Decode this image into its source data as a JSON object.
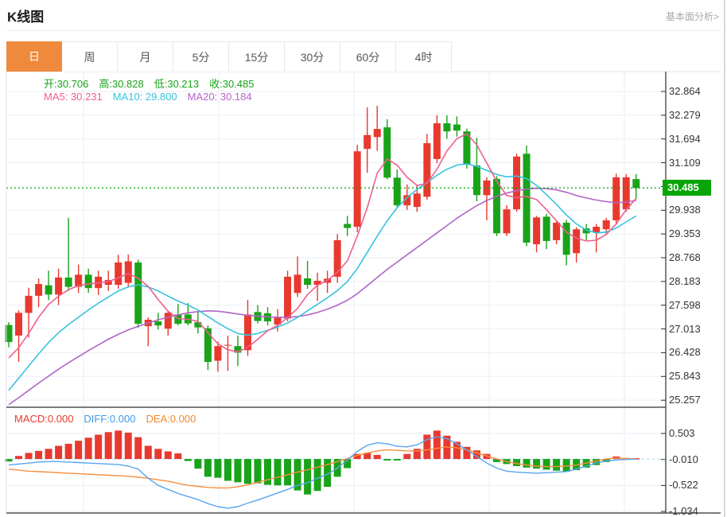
{
  "header": {
    "title": "K线图",
    "link": "基本面分析>"
  },
  "tabs": [
    {
      "name": "day",
      "label": "日",
      "active": true
    },
    {
      "name": "week",
      "label": "周",
      "active": false
    },
    {
      "name": "month",
      "label": "月",
      "active": false
    },
    {
      "name": "5min",
      "label": "5分",
      "active": false
    },
    {
      "name": "15min",
      "label": "15分",
      "active": false
    },
    {
      "name": "30min",
      "label": "30分",
      "active": false
    },
    {
      "name": "60min",
      "label": "60分",
      "active": false
    },
    {
      "name": "4hour",
      "label": "4时",
      "active": false
    }
  ],
  "legend_ohlc": [
    "开:30.706",
    "高:30.828",
    "低:30.213",
    "收:30.485"
  ],
  "legend_ohlc_color": "#17a317",
  "legend_ma": [
    {
      "text": "MA5: 30.231",
      "color": "#ee5f8e"
    },
    {
      "text": "MA10: 29.800",
      "color": "#38c2de"
    },
    {
      "text": "MA20: 30.184",
      "color": "#b264c8"
    }
  ],
  "legend_macd": [
    {
      "text": "MACD:0.000",
      "color": "#e8392f"
    },
    {
      "text": "DIFF:0.000",
      "color": "#3d9bea"
    },
    {
      "text": "DEA:0.000",
      "color": "#f0882c"
    }
  ],
  "price_axis": {
    "current": "30.485",
    "ticks": [
      {
        "label": "32.864",
        "value": 32.864
      },
      {
        "label": "32.279",
        "value": 32.279
      },
      {
        "label": "31.694",
        "value": 31.694
      },
      {
        "label": "31.109",
        "value": 31.109
      },
      {
        "label": "",
        "value": 30.524
      },
      {
        "label": "29.938",
        "value": 29.938
      },
      {
        "label": "29.353",
        "value": 29.353
      },
      {
        "label": "28.768",
        "value": 28.768
      },
      {
        "label": "28.183",
        "value": 28.183
      },
      {
        "label": "27.598",
        "value": 27.598
      },
      {
        "label": "27.013",
        "value": 27.013
      },
      {
        "label": "26.428",
        "value": 26.428
      },
      {
        "label": "25.843",
        "value": 25.843
      },
      {
        "label": "25.257",
        "value": 25.257
      }
    ]
  },
  "macd_axis": {
    "ticks": [
      {
        "label": "0.503",
        "value": 0.503
      },
      {
        "label": "-0.010",
        "value": -0.01
      },
      {
        "label": "-0.522",
        "value": -0.522
      },
      {
        "label": "-1.034",
        "value": -1.034
      }
    ]
  },
  "chart_data": {
    "type": "candlestick",
    "panels": [
      "price",
      "macd"
    ],
    "ohlc_current": {
      "open": 30.706,
      "high": 30.828,
      "low": 30.213,
      "close": 30.485
    },
    "ma_current": {
      "ma5": 30.231,
      "ma10": 29.8,
      "ma20": 30.184
    },
    "macd_current": {
      "macd": 0.0,
      "diff": 0.0,
      "dea": 0.0
    },
    "current_price": 30.485,
    "price_tick_step": 0.585,
    "ylim": [
      25.08,
      33.35
    ],
    "macd_ylim": [
      -1.07,
      0.55
    ],
    "candles": [
      [
        27.11,
        27.18,
        26.56,
        26.69
      ],
      [
        26.85,
        27.47,
        26.2,
        27.41
      ],
      [
        27.41,
        28.03,
        26.8,
        27.83
      ],
      [
        27.83,
        28.26,
        27.55,
        28.12
      ],
      [
        28.09,
        28.45,
        27.72,
        27.86
      ],
      [
        27.86,
        28.5,
        27.6,
        28.28
      ],
      [
        28.28,
        29.75,
        27.95,
        28.05
      ],
      [
        28.05,
        28.6,
        27.9,
        28.35
      ],
      [
        28.35,
        28.5,
        27.9,
        28.02
      ],
      [
        28.02,
        28.45,
        27.85,
        28.3
      ],
      [
        28.1,
        28.45,
        27.95,
        28.22
      ],
      [
        28.1,
        28.84,
        28.0,
        28.65
      ],
      [
        28.15,
        28.85,
        28.05,
        28.68
      ],
      [
        28.65,
        28.72,
        27.04,
        27.14
      ],
      [
        27.08,
        27.3,
        26.59,
        27.24
      ],
      [
        27.2,
        27.41,
        27.0,
        27.1
      ],
      [
        27.02,
        27.45,
        26.85,
        27.41
      ],
      [
        27.37,
        27.63,
        27.1,
        27.14
      ],
      [
        27.37,
        27.65,
        27.1,
        27.15
      ],
      [
        27.18,
        27.45,
        26.9,
        27.05
      ],
      [
        27.03,
        27.1,
        26.0,
        26.2
      ],
      [
        26.23,
        26.7,
        25.96,
        26.59
      ],
      [
        26.6,
        26.85,
        25.98,
        26.62
      ],
      [
        26.59,
        26.85,
        26.1,
        26.43
      ],
      [
        26.49,
        27.73,
        26.35,
        27.37
      ],
      [
        27.43,
        27.6,
        27.15,
        27.21
      ],
      [
        27.4,
        27.55,
        27.1,
        27.2
      ],
      [
        27.12,
        27.5,
        26.95,
        27.31
      ],
      [
        27.27,
        28.45,
        27.2,
        28.3
      ],
      [
        27.9,
        28.8,
        27.8,
        28.35
      ],
      [
        28.26,
        28.69,
        28.0,
        28.1
      ],
      [
        28.1,
        28.4,
        27.7,
        28.2
      ],
      [
        28.15,
        28.45,
        27.9,
        28.25
      ],
      [
        28.3,
        29.35,
        28.15,
        29.2
      ],
      [
        29.6,
        29.8,
        29.3,
        29.5
      ],
      [
        29.53,
        31.55,
        29.4,
        31.39
      ],
      [
        31.45,
        32.47,
        30.86,
        31.79
      ],
      [
        31.74,
        32.51,
        31.4,
        31.94
      ],
      [
        31.98,
        32.18,
        30.7,
        30.74
      ],
      [
        30.74,
        30.94,
        30.0,
        30.06
      ],
      [
        30.06,
        30.57,
        29.95,
        30.31
      ],
      [
        30.02,
        30.55,
        29.9,
        30.35
      ],
      [
        30.27,
        31.82,
        30.2,
        31.59
      ],
      [
        31.2,
        32.28,
        31.1,
        32.08
      ],
      [
        32.08,
        32.28,
        31.7,
        31.88
      ],
      [
        32.05,
        32.25,
        31.75,
        31.9
      ],
      [
        31.88,
        31.95,
        30.96,
        31.06
      ],
      [
        31.04,
        31.72,
        30.16,
        30.31
      ],
      [
        30.31,
        30.75,
        29.69,
        30.67
      ],
      [
        30.71,
        30.78,
        29.3,
        29.37
      ],
      [
        29.37,
        30.06,
        29.3,
        29.96
      ],
      [
        29.96,
        31.33,
        29.9,
        31.26
      ],
      [
        31.33,
        31.53,
        29.05,
        29.14
      ],
      [
        29.1,
        29.8,
        28.9,
        29.76
      ],
      [
        29.78,
        29.85,
        28.98,
        29.18
      ],
      [
        29.2,
        29.7,
        29.1,
        29.63
      ],
      [
        29.63,
        29.7,
        28.58,
        28.84
      ],
      [
        28.88,
        29.52,
        28.65,
        29.47
      ],
      [
        29.49,
        29.6,
        29.2,
        29.37
      ],
      [
        29.39,
        29.6,
        28.9,
        29.53
      ],
      [
        29.47,
        29.75,
        29.35,
        29.69
      ],
      [
        29.69,
        30.84,
        29.6,
        30.75
      ],
      [
        29.96,
        30.83,
        29.9,
        30.75
      ],
      [
        30.706,
        30.828,
        30.213,
        30.485
      ]
    ],
    "ma5": [
      26.3,
      26.55,
      26.9,
      27.3,
      27.62,
      27.82,
      27.98,
      28.08,
      28.12,
      28.15,
      28.18,
      28.27,
      28.38,
      28.26,
      28.06,
      27.74,
      27.45,
      27.27,
      27.25,
      27.2,
      26.92,
      26.65,
      26.5,
      26.45,
      26.56,
      26.76,
      26.97,
      27.1,
      27.29,
      27.52,
      27.86,
      28.09,
      28.21,
      28.41,
      28.69,
      29.3,
      30.0,
      30.85,
      31.2,
      31.05,
      30.75,
      30.55,
      30.6,
      30.95,
      31.4,
      31.7,
      31.82,
      31.55,
      31.1,
      30.65,
      30.3,
      30.25,
      30.28,
      30.2,
      29.95,
      29.68,
      29.4,
      29.25,
      29.18,
      29.2,
      29.34,
      29.6,
      29.95,
      30.23
    ],
    "ma10": [
      25.5,
      25.8,
      26.1,
      26.4,
      26.68,
      26.92,
      27.12,
      27.3,
      27.48,
      27.65,
      27.8,
      27.95,
      28.05,
      28.1,
      28.05,
      27.95,
      27.82,
      27.7,
      27.6,
      27.48,
      27.32,
      27.16,
      27.02,
      26.9,
      26.86,
      26.9,
      26.98,
      27.06,
      27.16,
      27.3,
      27.46,
      27.62,
      27.78,
      27.96,
      28.18,
      28.5,
      28.9,
      29.3,
      29.68,
      30.0,
      30.25,
      30.45,
      30.62,
      30.8,
      30.95,
      31.05,
      31.08,
      31.02,
      30.92,
      30.82,
      30.76,
      30.78,
      30.72,
      30.55,
      30.32,
      30.08,
      29.82,
      29.6,
      29.45,
      29.38,
      29.4,
      29.5,
      29.65,
      29.8
    ],
    "ma20": [
      25.15,
      25.32,
      25.5,
      25.68,
      25.85,
      26.02,
      26.18,
      26.33,
      26.48,
      26.62,
      26.76,
      26.88,
      26.99,
      27.08,
      27.16,
      27.24,
      27.3,
      27.36,
      27.41,
      27.44,
      27.46,
      27.45,
      27.42,
      27.38,
      27.35,
      27.33,
      27.31,
      27.3,
      27.3,
      27.32,
      27.36,
      27.42,
      27.5,
      27.6,
      27.72,
      27.88,
      28.08,
      28.28,
      28.48,
      28.66,
      28.84,
      29.02,
      29.2,
      29.38,
      29.56,
      29.74,
      29.9,
      30.05,
      30.18,
      30.28,
      30.36,
      30.42,
      30.46,
      30.48,
      30.47,
      30.44,
      30.38,
      30.3,
      30.24,
      30.19,
      30.15,
      30.12,
      30.14,
      30.18
    ],
    "macd": {
      "hist": [
        -0.05,
        0.06,
        0.12,
        0.16,
        0.2,
        0.26,
        0.3,
        0.36,
        0.42,
        0.48,
        0.53,
        0.56,
        0.52,
        0.43,
        0.26,
        0.2,
        0.15,
        0.11,
        -0.04,
        -0.19,
        -0.35,
        -0.37,
        -0.43,
        -0.46,
        -0.49,
        -0.48,
        -0.51,
        -0.52,
        -0.52,
        -0.62,
        -0.7,
        -0.63,
        -0.55,
        -0.35,
        -0.18,
        0.1,
        0.12,
        0.08,
        -0.03,
        -0.03,
        0.1,
        0.2,
        0.48,
        0.56,
        0.46,
        0.34,
        0.24,
        0.17,
        0.1,
        -0.06,
        -0.1,
        -0.14,
        -0.17,
        -0.19,
        -0.21,
        -0.23,
        -0.25,
        -0.22,
        -0.17,
        -0.12,
        -0.06,
        0.05,
        0.02,
        0.0
      ],
      "diff": [
        -0.12,
        -0.1,
        -0.08,
        -0.06,
        -0.05,
        -0.05,
        -0.06,
        -0.07,
        -0.08,
        -0.09,
        -0.1,
        -0.11,
        -0.14,
        -0.2,
        -0.38,
        -0.52,
        -0.6,
        -0.68,
        -0.74,
        -0.8,
        -0.88,
        -0.94,
        -0.97,
        -0.94,
        -0.87,
        -0.81,
        -0.74,
        -0.67,
        -0.6,
        -0.52,
        -0.47,
        -0.38,
        -0.3,
        -0.18,
        -0.02,
        0.15,
        0.27,
        0.32,
        0.3,
        0.25,
        0.24,
        0.28,
        0.38,
        0.44,
        0.4,
        0.3,
        0.18,
        0.05,
        -0.08,
        -0.18,
        -0.24,
        -0.26,
        -0.27,
        -0.28,
        -0.27,
        -0.26,
        -0.25,
        -0.2,
        -0.14,
        -0.08,
        -0.04,
        -0.02,
        -0.01,
        0.0
      ],
      "dea": [
        -0.2,
        -0.22,
        -0.24,
        -0.25,
        -0.26,
        -0.27,
        -0.28,
        -0.29,
        -0.3,
        -0.31,
        -0.32,
        -0.33,
        -0.34,
        -0.36,
        -0.38,
        -0.41,
        -0.44,
        -0.48,
        -0.52,
        -0.54,
        -0.56,
        -0.57,
        -0.57,
        -0.55,
        -0.51,
        -0.46,
        -0.41,
        -0.36,
        -0.31,
        -0.26,
        -0.21,
        -0.16,
        -0.11,
        -0.05,
        0.01,
        0.07,
        0.12,
        0.16,
        0.18,
        0.17,
        0.16,
        0.16,
        0.18,
        0.21,
        0.24,
        0.22,
        0.18,
        0.12,
        0.06,
        0.0,
        -0.05,
        -0.09,
        -0.12,
        -0.14,
        -0.15,
        -0.15,
        -0.14,
        -0.12,
        -0.08,
        -0.04,
        0.0,
        0.02,
        0.01,
        0.0
      ]
    },
    "colors": {
      "up": "#e8392f",
      "down": "#1aa31a",
      "ma5": "#ee5f8e",
      "ma10": "#38c2de",
      "ma20": "#b264c8",
      "diff_line": "#58a6ee",
      "dea_line": "#f58f3d",
      "current_bg": "#07a507",
      "current_line": "#07a507",
      "grid": "#e9eef5",
      "frame": "#2e2e2e",
      "zero_line": "#a9d7f2",
      "tab_active": "#EF8A3D"
    }
  }
}
